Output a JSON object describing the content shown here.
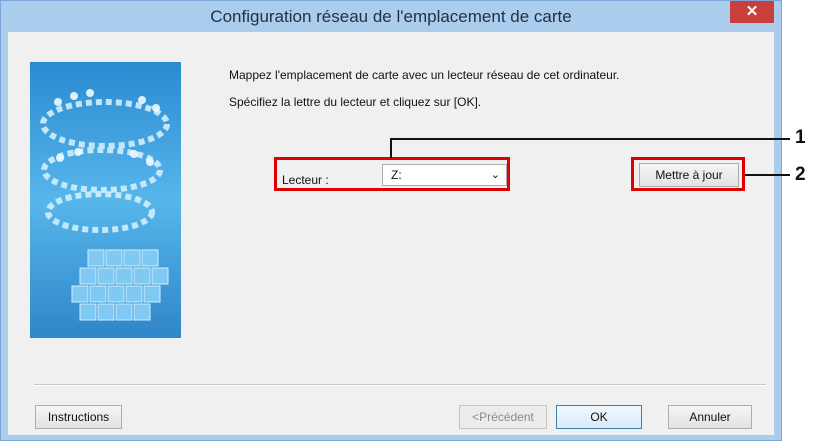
{
  "window": {
    "title": "Configuration réseau de l'emplacement de carte",
    "close_glyph": "✕"
  },
  "content": {
    "message1": "Mappez l'emplacement de carte avec un lecteur réseau de cet ordinateur.",
    "message2": "Spécifiez la lettre du lecteur et cliquez sur [OK].",
    "drive_label": "Lecteur :",
    "drive_value": "Z:",
    "update_button": "Mettre à jour"
  },
  "buttons": {
    "instructions": "Instructions",
    "previous": "<Précédent",
    "ok": "OK",
    "cancel": "Annuler"
  },
  "callouts": [
    "1",
    "2"
  ],
  "icons": {
    "close": "close-icon",
    "dropdown": "chevron-down-icon"
  },
  "colors": {
    "highlight": "#e00000",
    "titlebar": "#aacdee",
    "close_button": "#c9403a"
  }
}
